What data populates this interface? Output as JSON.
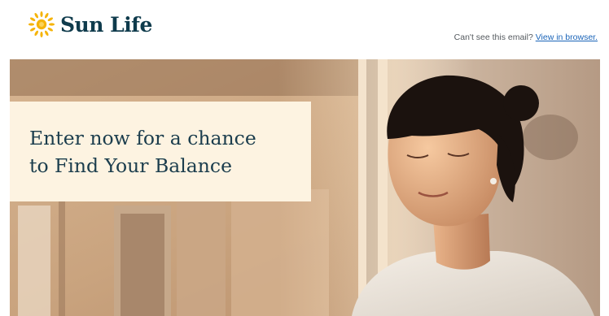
{
  "header": {
    "brand_name": "Sun Life",
    "logo_icon": "sun-icon",
    "view_prefix": "Can't see this email?",
    "view_link": "View in browser.",
    "brand_color": "#0f3b4c",
    "accent_color": "#f5b40a",
    "link_color": "#1a64b8"
  },
  "hero": {
    "headline": "Enter now for a chance\nto Find Your Balance",
    "card_color": "#fdf3e1",
    "headline_color": "#1b3d4d",
    "image_subject": "woman-basking-in-sunlight"
  }
}
